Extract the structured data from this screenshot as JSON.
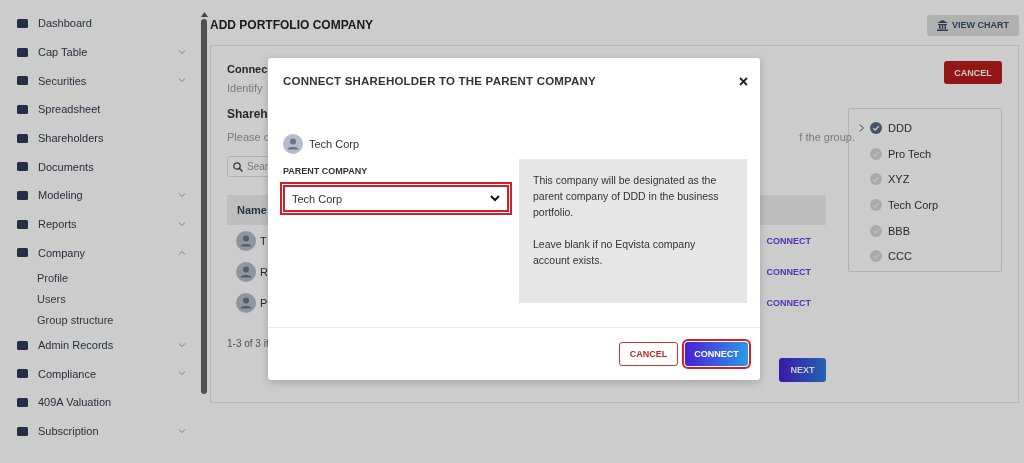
{
  "sidebar": {
    "items": [
      {
        "label": "Dashboard"
      },
      {
        "label": "Cap Table",
        "expanded": false
      },
      {
        "label": "Securities",
        "expanded": false
      },
      {
        "label": "Spreadsheet"
      },
      {
        "label": "Shareholders"
      },
      {
        "label": "Documents"
      },
      {
        "label": "Modeling",
        "expanded": false
      },
      {
        "label": "Reports",
        "expanded": false
      },
      {
        "label": "Company",
        "expanded": true,
        "children": [
          {
            "label": "Profile"
          },
          {
            "label": "Users"
          },
          {
            "label": "Group structure"
          }
        ]
      },
      {
        "label": "Admin Records",
        "expanded": false
      },
      {
        "label": "Compliance",
        "expanded": false
      },
      {
        "label": "409A Valuation"
      },
      {
        "label": "Subscription",
        "expanded": false
      }
    ]
  },
  "page": {
    "title": "ADD PORTFOLIO COMPANY",
    "view_chart_button": "VIEW CHART",
    "cancel_button": "CANCEL",
    "section_title": "Connec",
    "section_hint": "Identify",
    "subsection_title": "Shareh",
    "subsection_hint": "Please c",
    "hint_tail": "f the group.",
    "search": {
      "placeholder": "Sear"
    },
    "table": {
      "columns": [
        "Name"
      ],
      "rows": [
        {
          "name": "T",
          "action": "CONNECT"
        },
        {
          "name": "R",
          "action": "CONNECT"
        },
        {
          "name": "P",
          "action": "CONNECT"
        }
      ]
    },
    "pagination": "1-3 of 3 it",
    "next_button": "NEXT"
  },
  "tree": {
    "items": [
      {
        "label": "DDD",
        "selected": true,
        "expanded": false
      },
      {
        "label": "Pro Tech",
        "selected": false
      },
      {
        "label": "XYZ",
        "selected": false
      },
      {
        "label": "Tech Corp",
        "selected": false
      },
      {
        "label": "BBB",
        "selected": false
      },
      {
        "label": "CCC",
        "selected": false
      }
    ]
  },
  "modal": {
    "title": "CONNECT SHAREHOLDER TO THE PARENT COMPANY",
    "shareholder": "Tech Corp",
    "field_label": "PARENT COMPANY",
    "select": {
      "value": "Tech Corp",
      "highlighted": true
    },
    "info": [
      "This company will be designated as the parent company of DDD in the business portfolio.",
      "Leave blank if no Eqvista company account exists."
    ],
    "buttons": [
      {
        "label": "CANCEL",
        "kind": "secondary",
        "highlighted": false
      },
      {
        "label": "CONNECT",
        "kind": "primary",
        "highlighted": true
      }
    ]
  }
}
